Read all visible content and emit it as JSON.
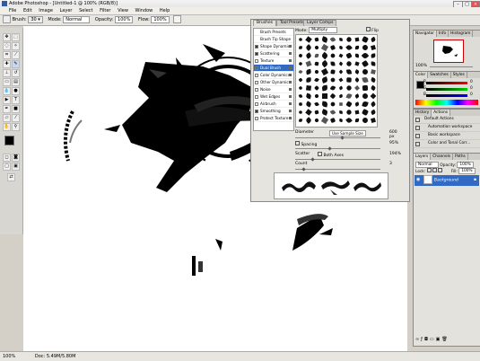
{
  "window": {
    "title": "Adobe Photoshop - [Untitled-1 @ 100% (RGB/8)]"
  },
  "menubar": {
    "items": [
      "File",
      "Edit",
      "Image",
      "Layer",
      "Select",
      "Filter",
      "View",
      "Window",
      "Help"
    ]
  },
  "options": {
    "brush_label": "Brush:",
    "brush_size": "30",
    "mode_label": "Mode:",
    "mode_value": "Normal",
    "opacity_label": "Opacity:",
    "opacity_value": "100%",
    "flow_label": "Flow:",
    "flow_value": "100%"
  },
  "brushes_panel": {
    "tabs": [
      "Brushes",
      "Tool Presets",
      "Layer Comps"
    ],
    "mode_label": "Mode:",
    "mode_value": "Multiply",
    "flip_label": "Flip",
    "list": [
      {
        "label": "Brush Presets",
        "checked": false
      },
      {
        "label": "Brush Tip Shape",
        "checked": false
      },
      {
        "label": "Shape Dynamics",
        "checked": true
      },
      {
        "label": "Scattering",
        "checked": true
      },
      {
        "label": "Texture",
        "checked": false
      },
      {
        "label": "Dual Brush",
        "checked": false
      },
      {
        "label": "Color Dynamics",
        "checked": false
      },
      {
        "label": "Other Dynamics",
        "checked": false
      },
      {
        "label": "Noise",
        "checked": false
      },
      {
        "label": "Wet Edges",
        "checked": false
      },
      {
        "label": "Airbrush",
        "checked": false
      },
      {
        "label": "Smoothing",
        "checked": true
      },
      {
        "label": "Protect Texture",
        "checked": false
      }
    ],
    "selected_index": 5,
    "diameter_label": "Diameter",
    "use_sample_size": "Use Sample Size",
    "diameter_value": "600 px",
    "diameter_level": 0.55,
    "spacing_label": "Spacing",
    "spacing_value": "95%",
    "spacing_level": 0.4,
    "scatter_label": "Scatter",
    "both_axes_label": "Both Axes",
    "scatter_value": "194%",
    "scatter_level": 0.2,
    "count_label": "Count",
    "count_value": "3",
    "count_level": 0.1
  },
  "navigator": {
    "tabs": [
      "Navigator",
      "Info",
      "Histogram"
    ],
    "zoom": "100%"
  },
  "color": {
    "tabs": [
      "Color",
      "Swatches",
      "Styles"
    ],
    "channels": [
      "R",
      "G",
      "B"
    ],
    "values": [
      "0",
      "0",
      "0"
    ]
  },
  "actions": {
    "tabs": [
      "History",
      "Actions"
    ],
    "items": [
      "Default Actions",
      "Automation workspace",
      "Basic workspace",
      "Color and Tonal Corr..."
    ]
  },
  "layers": {
    "tabs": [
      "Layers",
      "Channels",
      "Paths"
    ],
    "blend": "Normal",
    "opacity_label": "Opacity:",
    "opacity": "100%",
    "lock_label": "Lock:",
    "fill_label": "Fill:",
    "fill": "100%",
    "layer_name": "Background"
  },
  "status": {
    "zoom": "100%",
    "doc": "Doc: 5.49M/5.80M"
  },
  "colors": {
    "selection": "#316ac5",
    "panel": "#dedcd6",
    "foreground": "#000000",
    "background": "#ffffff"
  }
}
